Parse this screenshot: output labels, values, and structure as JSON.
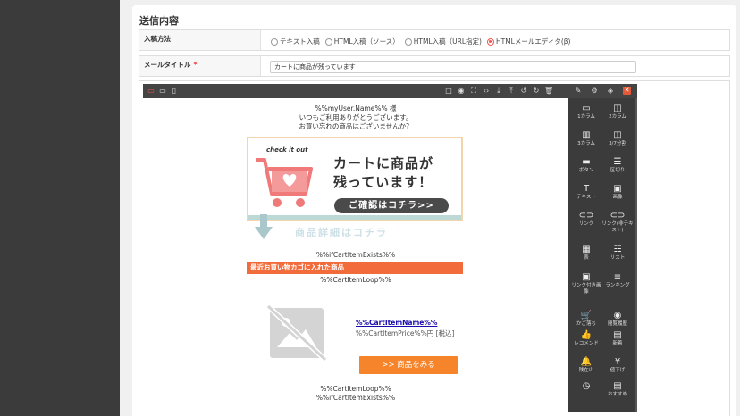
{
  "section": {
    "title": "送信内容"
  },
  "input_method": {
    "label": "入稿方法",
    "options": [
      {
        "label": "テキスト入稿",
        "checked": false
      },
      {
        "label": "HTML入稿（ソース）",
        "checked": false
      },
      {
        "label": "HTML入稿（URL指定)",
        "checked": false
      },
      {
        "label": "HTMLメールエディタ(β)",
        "checked": true
      }
    ]
  },
  "mail_title": {
    "label": "メールタイトル",
    "required_mark": "*",
    "value": "カートに商品が残っています"
  },
  "toolbar": {
    "icons": [
      "desktop-icon",
      "tablet-icon",
      "mobile-icon",
      "square-icon",
      "eye-icon",
      "fullscreen-icon",
      "code-icon",
      "download-icon",
      "upload-icon",
      "undo-icon",
      "redo-icon",
      "trash-icon",
      "brush-icon",
      "gear-icon",
      "layers-icon",
      "close-icon"
    ]
  },
  "blocks": [
    {
      "label": "1カラム",
      "icon": "one-column-icon"
    },
    {
      "label": "2カラム",
      "icon": "two-column-icon"
    },
    {
      "label": "3カラム",
      "icon": "three-column-icon"
    },
    {
      "label": "3/7分割",
      "icon": "split-column-icon"
    },
    {
      "label": "ボタン",
      "icon": "button-icon"
    },
    {
      "label": "区切り",
      "icon": "divider-icon"
    },
    {
      "label": "テキスト",
      "icon": "text-icon"
    },
    {
      "label": "画像",
      "icon": "image-icon"
    },
    {
      "label": "リンク",
      "icon": "link-icon"
    },
    {
      "label": "リンク(非テキスト)",
      "icon": "link-icon"
    },
    {
      "label": "表",
      "icon": "table-icon"
    },
    {
      "label": "リスト",
      "icon": "list-icon"
    },
    {
      "label": "リンク付き画像",
      "icon": "linked-image-icon"
    },
    {
      "label": "ランキング",
      "icon": "ranking-icon"
    },
    {
      "label": "かご落ち",
      "icon": "cart-icon"
    },
    {
      "label": "閲覧履歴",
      "icon": "eye-icon"
    },
    {
      "label": "レコメンド",
      "icon": "thumbs-up-icon"
    },
    {
      "label": "新着",
      "icon": "new-icon"
    },
    {
      "label": "残在少",
      "icon": "bell-icon"
    },
    {
      "label": "値下げ",
      "icon": "yen-icon"
    },
    {
      "label": "",
      "icon": "clock-icon"
    },
    {
      "label": "おすすめ",
      "icon": "recommend-icon"
    }
  ],
  "email": {
    "greeting_name": "%%myUser.Name%% 様",
    "line1": "いつもご利用ありがとうございます。",
    "line2": "お買い忘れの商品はございませんか？",
    "banner": {
      "badge": "check it out",
      "title_line1": "カートに商品が",
      "title_line2": "残っています！",
      "button": "ご確認はコチラ>>"
    },
    "detail_text": "商品詳細はコチラ",
    "if_exists_open": "%%ifCartItemExists%%",
    "section_bar": "最近お買い物カゴに入れた商品",
    "loop_open": "%%CartItemLoop%%",
    "item_name": "%%CartItemName%%",
    "item_price": "%%CartItemPrice%%円 [税込]",
    "view_button": ">> 商品をみる",
    "loop_close": "%%CartItemLoop%%",
    "if_exists_close": "%%ifCartItemExists%%"
  }
}
